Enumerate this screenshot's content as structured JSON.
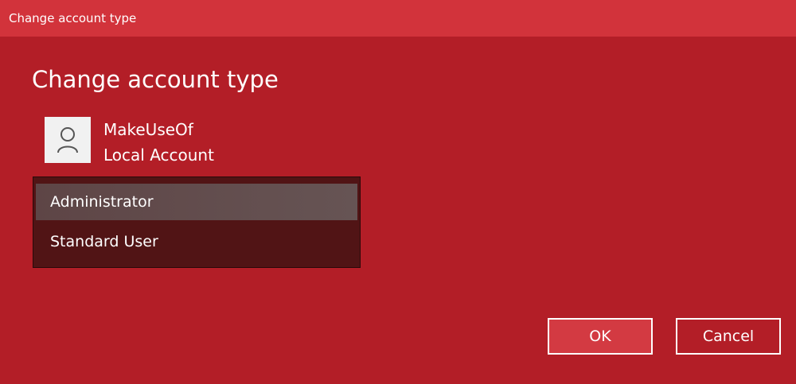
{
  "window": {
    "title": "Change account type"
  },
  "dialog": {
    "heading": "Change account type",
    "account": {
      "icon": "user-icon",
      "name": "MakeUseOf",
      "kind": "Local Account"
    },
    "account_types": {
      "options": [
        {
          "label": "Administrator",
          "selected": true
        },
        {
          "label": "Standard User",
          "selected": false
        }
      ]
    },
    "buttons": {
      "ok_label": "OK",
      "cancel_label": "Cancel"
    }
  },
  "colors": {
    "accent": "#b31e27",
    "titlebar": "#d2333b",
    "list_background": "#511415",
    "list_selected": "#665454"
  }
}
